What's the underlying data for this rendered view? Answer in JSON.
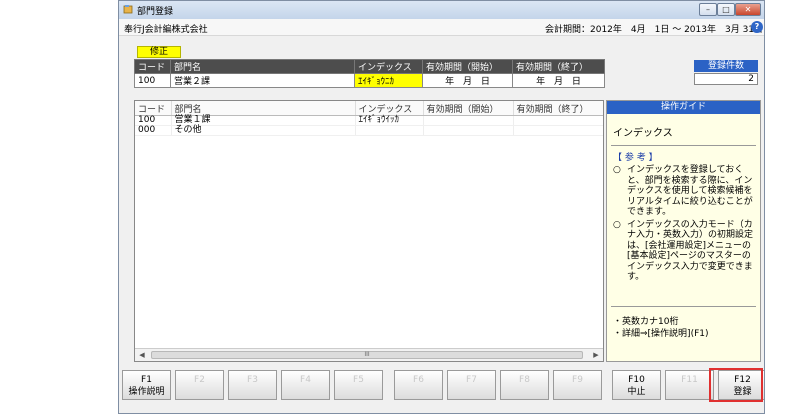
{
  "window": {
    "title": "部門登録",
    "company": "奉行J会計編株式会社",
    "period": "会計期間：2012年　4月　1日 ～ 2013年　3月 31日",
    "min": "–",
    "max": "□",
    "close": "✕",
    "help": "?"
  },
  "mode": "修正",
  "edit": {
    "headers": [
      "コード",
      "部門名",
      "インデックス",
      "有効期間（開始）",
      "有効期間（終了）"
    ],
    "row": [
      "100",
      "営業２課",
      "ｴｲｷﾞｮｳﾆｶ",
      "年 月 日",
      "年 月 日"
    ]
  },
  "count": {
    "label": "登録件数",
    "value": "2"
  },
  "list": {
    "headers": [
      "コード",
      "部門名",
      "インデックス",
      "有効期間（開始）",
      "有効期間（終了）"
    ],
    "rows": [
      [
        "100",
        "営業１課",
        "ｴｲｷﾞｮｳｲｯｶ",
        "",
        ""
      ],
      [
        "000",
        "その他",
        "",
        "",
        ""
      ]
    ],
    "scroll_left": "◀",
    "scroll_thumb": "III",
    "scroll_right": "▶"
  },
  "guide": {
    "header": "操作ガイド",
    "heading": "インデックス",
    "ref": "【 参 考 】",
    "bullet_mark": "○",
    "bullets": [
      "インデックスを登録しておくと、部門を検索する際に、インデックスを使用して検索候補をリアルタイムに絞り込むことができます。",
      "インデックスの入力モード（カナ入力・英数入力）の初期設定は、[会社運用設定]メニューの[基本設定]ページのマスターのインデックス入力で変更できます。"
    ],
    "notes": [
      "・英数カナ10桁",
      "・詳細⇒[操作説明](F1)"
    ]
  },
  "fkeys": [
    {
      "key": "F1",
      "label": "操作説明",
      "enabled": true
    },
    {
      "key": "F2",
      "label": "",
      "enabled": false
    },
    {
      "key": "F3",
      "label": "",
      "enabled": false
    },
    {
      "key": "F4",
      "label": "",
      "enabled": false
    },
    {
      "key": "F5",
      "label": "",
      "enabled": false
    },
    {
      "key": "F6",
      "label": "",
      "enabled": false
    },
    {
      "key": "F7",
      "label": "",
      "enabled": false
    },
    {
      "key": "F8",
      "label": "",
      "enabled": false
    },
    {
      "key": "F9",
      "label": "",
      "enabled": false
    },
    {
      "key": "F10",
      "label": "中止",
      "enabled": true
    },
    {
      "key": "F11",
      "label": "",
      "enabled": false
    },
    {
      "key": "F12",
      "label": "登録",
      "enabled": true
    }
  ],
  "colors": {
    "accent": "#2b62c5",
    "mode_highlight": "#ffff00",
    "focus_outline": "#e03030"
  }
}
